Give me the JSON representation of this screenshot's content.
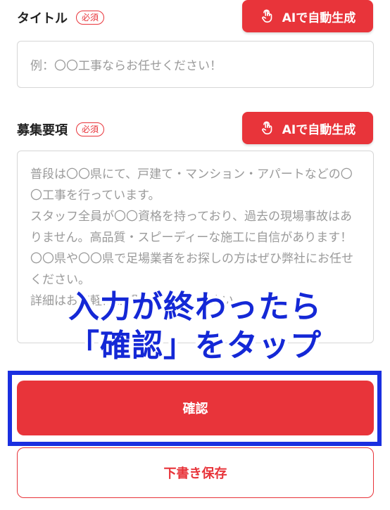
{
  "title_field": {
    "label": "タイトル",
    "required_badge": "必須",
    "ai_button_label": "AIで自動生成",
    "placeholder": "例：〇〇工事ならお任せください！"
  },
  "description_field": {
    "label": "募集要項",
    "required_badge": "必須",
    "ai_button_label": "AIで自動生成",
    "placeholder": "普段は〇〇県にて、戸建て・マンション・アパートなどの〇〇工事を行っています。\nスタッフ全員が〇〇資格を持っており、過去の現場事故はありません。高品質・スピーディーな施工に自信があります！\n〇〇県や〇〇県で足場業者をお探しの方はぜひ弊社にお任せください。\n詳細はお気軽にお問い合わせください。"
  },
  "overlay_annotation": {
    "line1": "入力が終わったら",
    "line2": "「確認」をタップ",
    "color": "#1428d6"
  },
  "actions": {
    "confirm_label": "確認",
    "draft_label": "下書き保存"
  },
  "colors": {
    "accent": "#e8343a",
    "highlight": "#1a2fe0"
  },
  "icons": {
    "ai_button_icon": "tap-hand-icon"
  }
}
